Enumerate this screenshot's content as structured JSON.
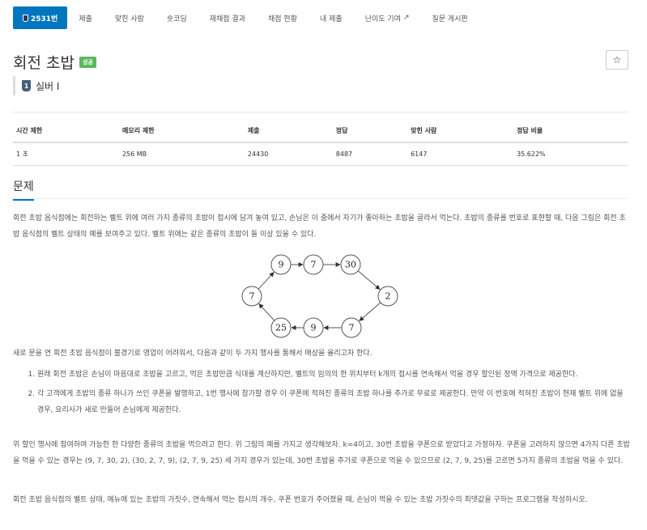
{
  "nav": {
    "items": [
      {
        "label": "2531번",
        "active": true,
        "icon": "tier-badge-icon"
      },
      {
        "label": "제출"
      },
      {
        "label": "맞힌 사람"
      },
      {
        "label": "숏코딩"
      },
      {
        "label": "재채점 결과"
      },
      {
        "label": "채점 현황"
      },
      {
        "label": "내 제출"
      },
      {
        "label": "난이도 기여",
        "icon": "external-link-icon"
      },
      {
        "label": "질문 게시판"
      }
    ]
  },
  "problem": {
    "title": "회전 초밥",
    "status_badge": "성공",
    "star_label": "☆",
    "tier_icon_text": "1",
    "tier_label": "실버 I"
  },
  "info_table": {
    "headers": [
      "시간 제한",
      "메모리 제한",
      "제출",
      "정답",
      "맞힌 사람",
      "정답 비율"
    ],
    "row": [
      "1 초",
      "256 MB",
      "24430",
      "8487",
      "6147",
      "35.622%"
    ]
  },
  "section": {
    "title": "문제"
  },
  "body": {
    "p1": "회전 초밥 음식점에는 회전하는 벨트 위에 여러 가지 종류의 초밥이 접시에 담겨 놓여 있고, 손님은 이 중에서 자기가 좋아하는 초밥을 골라서 먹는다. 초밥의 종류를 번호로 표현할 때, 다음 그림은 회전 초밥 음식점의 벨트 상태의 예를 보여주고 있다. 벨트 위에는 같은 종류의 초밥이 둘 이상 있을 수 있다.",
    "p2": "새로 문을 연 회전 초밥 음식점이 불경기로 영업이 어려워서, 다음과 같이 두 가지 행사를 통해서 매상을 올리고자 한다.",
    "rules": [
      "원래 회전 초밥은 손님이 마음대로 초밥을 고르고, 먹은 초밥만큼 식대를 계산하지만, 벨트의 임의의 한 위치부터 k개의 접시를 연속해서 먹을 경우 할인된 정액 가격으로 제공한다.",
      "각 고객에게 초밥의 종류 하나가 쓰인 쿠폰을 발행하고, 1번 행사에 참가할 경우 이 쿠폰에 적혀진 종류의 초밥 하나를 추가로 무료로 제공한다. 만약 이 번호에 적혀진 초밥이 현재 벨트 위에 없을 경우, 요리사가 새로 만들어 손님에게 제공한다."
    ],
    "p3": "위 할인 행사에 참여하여 가능한 한 다양한 종류의 초밥을 먹으려고 한다. 위 그림의 예를 가지고 생각해보자. k=4이고, 30번 초밥을 쿠폰으로 받았다고 가정하자. 쿠폰을 고려하지 않으면 4가지 다른 초밥을 먹을 수 있는 경우는 (9, 7, 30, 2), (30, 2, 7, 9), (2, 7, 9, 25) 세 가지 경우가 있는데, 30번 초밥을 추가로 쿠폰으로 먹을 수 있으므로 (2, 7, 9, 25)를 고르면 5가지 종류의 초밥을 먹을 수 있다.",
    "p4": "회전 초밥 음식점의 벨트 상태, 메뉴에 있는 초밥의 가짓수, 연속해서 먹는 접시의 개수, 쿠폰 번호가 주어졌을 때, 손님이 먹을 수 있는 초밥 가짓수의 최댓값을 구하는 프로그램을 작성하시오."
  },
  "figure": {
    "belt": [
      "9",
      "7",
      "30",
      "2",
      "7",
      "9",
      "25",
      "7"
    ]
  },
  "colors": {
    "accent": "#0076c0",
    "success": "#5cb85c",
    "tier_silver": "#435f7a"
  }
}
